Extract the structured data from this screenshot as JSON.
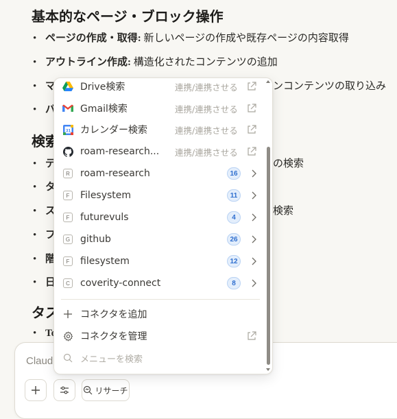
{
  "doc": {
    "heading1": "基本的なページ・ブロック操作",
    "bullets": [
      {
        "bold": "ページの作成・取得:",
        "text": " 新しいページの作成や既存ページの内容取得"
      },
      {
        "bold": "アウトライン作成:",
        "text": " 構造化されたコンテンツの追加"
      },
      {
        "bold": "マ",
        "text": "",
        "right": "ンコンテンツの取り込み"
      },
      {
        "bold": "バ",
        "text": ""
      }
    ],
    "heading2": "検索",
    "bullets2": [
      {
        "bold": "テ",
        "right": "の検索"
      },
      {
        "bold": "タ",
        "right": ""
      },
      {
        "bold": "ス",
        "right": "検索"
      },
      {
        "bold": "フ",
        "right": ""
      },
      {
        "bold": "階",
        "right": ""
      },
      {
        "bold": "日",
        "right": ""
      }
    ],
    "heading3": "タス",
    "bullets3": [
      {
        "bold": "To"
      }
    ]
  },
  "composer": {
    "placeholder": "Claud",
    "research_label": "リサーチ"
  },
  "menu": {
    "connected_items": [
      {
        "label": "Drive検索",
        "status": "連携/連携させる",
        "icon": "google-drive-icon"
      },
      {
        "label": "Gmail検索",
        "status": "連携/連携させる",
        "icon": "gmail-icon"
      },
      {
        "label": "カレンダー検索",
        "status": "連携/連携させる",
        "icon": "google-calendar-icon"
      },
      {
        "label": "roam-research...",
        "status": "連携/連携させる",
        "icon": "github-icon"
      }
    ],
    "tool_items": [
      {
        "label": "roam-research",
        "letter": "R",
        "count": "16"
      },
      {
        "label": "Filesystem",
        "letter": "F",
        "count": "11"
      },
      {
        "label": "futurevuls",
        "letter": "F",
        "count": "4"
      },
      {
        "label": "github",
        "letter": "G",
        "count": "26"
      },
      {
        "label": "filesystem",
        "letter": "F",
        "count": "12"
      },
      {
        "label": "coverity-connect",
        "letter": "C",
        "count": "8"
      }
    ],
    "add_connector": "コネクタを追加",
    "manage_connector": "コネクタを管理",
    "search_placeholder": "メニューを検索"
  }
}
